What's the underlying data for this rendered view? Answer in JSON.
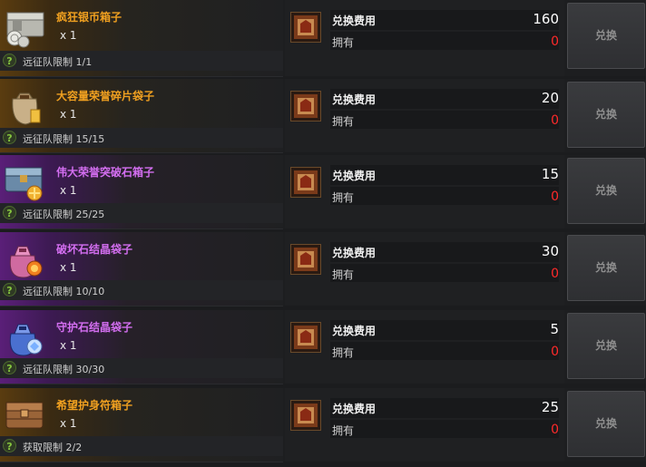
{
  "colors": {
    "gold_name": "#f0a020",
    "purple_name": "#d36ef0",
    "owned_zero": "#ff2a2a",
    "help_green": "#86c540",
    "button_text_disabled": "#8e8e8e"
  },
  "items": [
    {
      "name": "疯狂银币箱子",
      "rarity": "gold",
      "icon": "silver-coin-chest-icon",
      "quantity": "x 1",
      "limit": "远征队限制 1/1",
      "cost_label": "兑换费用",
      "cost": "160",
      "own_label": "拥有",
      "own": "0",
      "button": "兑换"
    },
    {
      "name": "大容量荣誉碎片袋子",
      "rarity": "gold",
      "icon": "honor-shard-bag-icon",
      "quantity": "x 1",
      "limit": "远征队限制 15/15",
      "cost_label": "兑换费用",
      "cost": "20",
      "own_label": "拥有",
      "own": "0",
      "button": "兑换"
    },
    {
      "name": "伟大荣誉突破石箱子",
      "rarity": "purple",
      "icon": "breakthrough-stone-chest-icon",
      "quantity": "x 1",
      "limit": "远征队限制 25/25",
      "cost_label": "兑换费用",
      "cost": "15",
      "own_label": "拥有",
      "own": "0",
      "button": "兑换"
    },
    {
      "name": "破坏石结晶袋子",
      "rarity": "purple",
      "icon": "destruction-stone-bag-icon",
      "quantity": "x 1",
      "limit": "远征队限制 10/10",
      "cost_label": "兑换费用",
      "cost": "30",
      "own_label": "拥有",
      "own": "0",
      "button": "兑换"
    },
    {
      "name": "守护石结晶袋子",
      "rarity": "purple",
      "icon": "guardian-stone-bag-icon",
      "quantity": "x 1",
      "limit": "远征队限制 30/30",
      "cost_label": "兑换费用",
      "cost": "5",
      "own_label": "拥有",
      "own": "0",
      "button": "兑换"
    },
    {
      "name": "希望护身符箱子",
      "rarity": "gold",
      "icon": "amulet-chest-icon",
      "quantity": "x 1",
      "limit": "获取限制 2/2",
      "cost_label": "兑换费用",
      "cost": "25",
      "own_label": "拥有",
      "own": "0",
      "button": "兑换"
    }
  ]
}
